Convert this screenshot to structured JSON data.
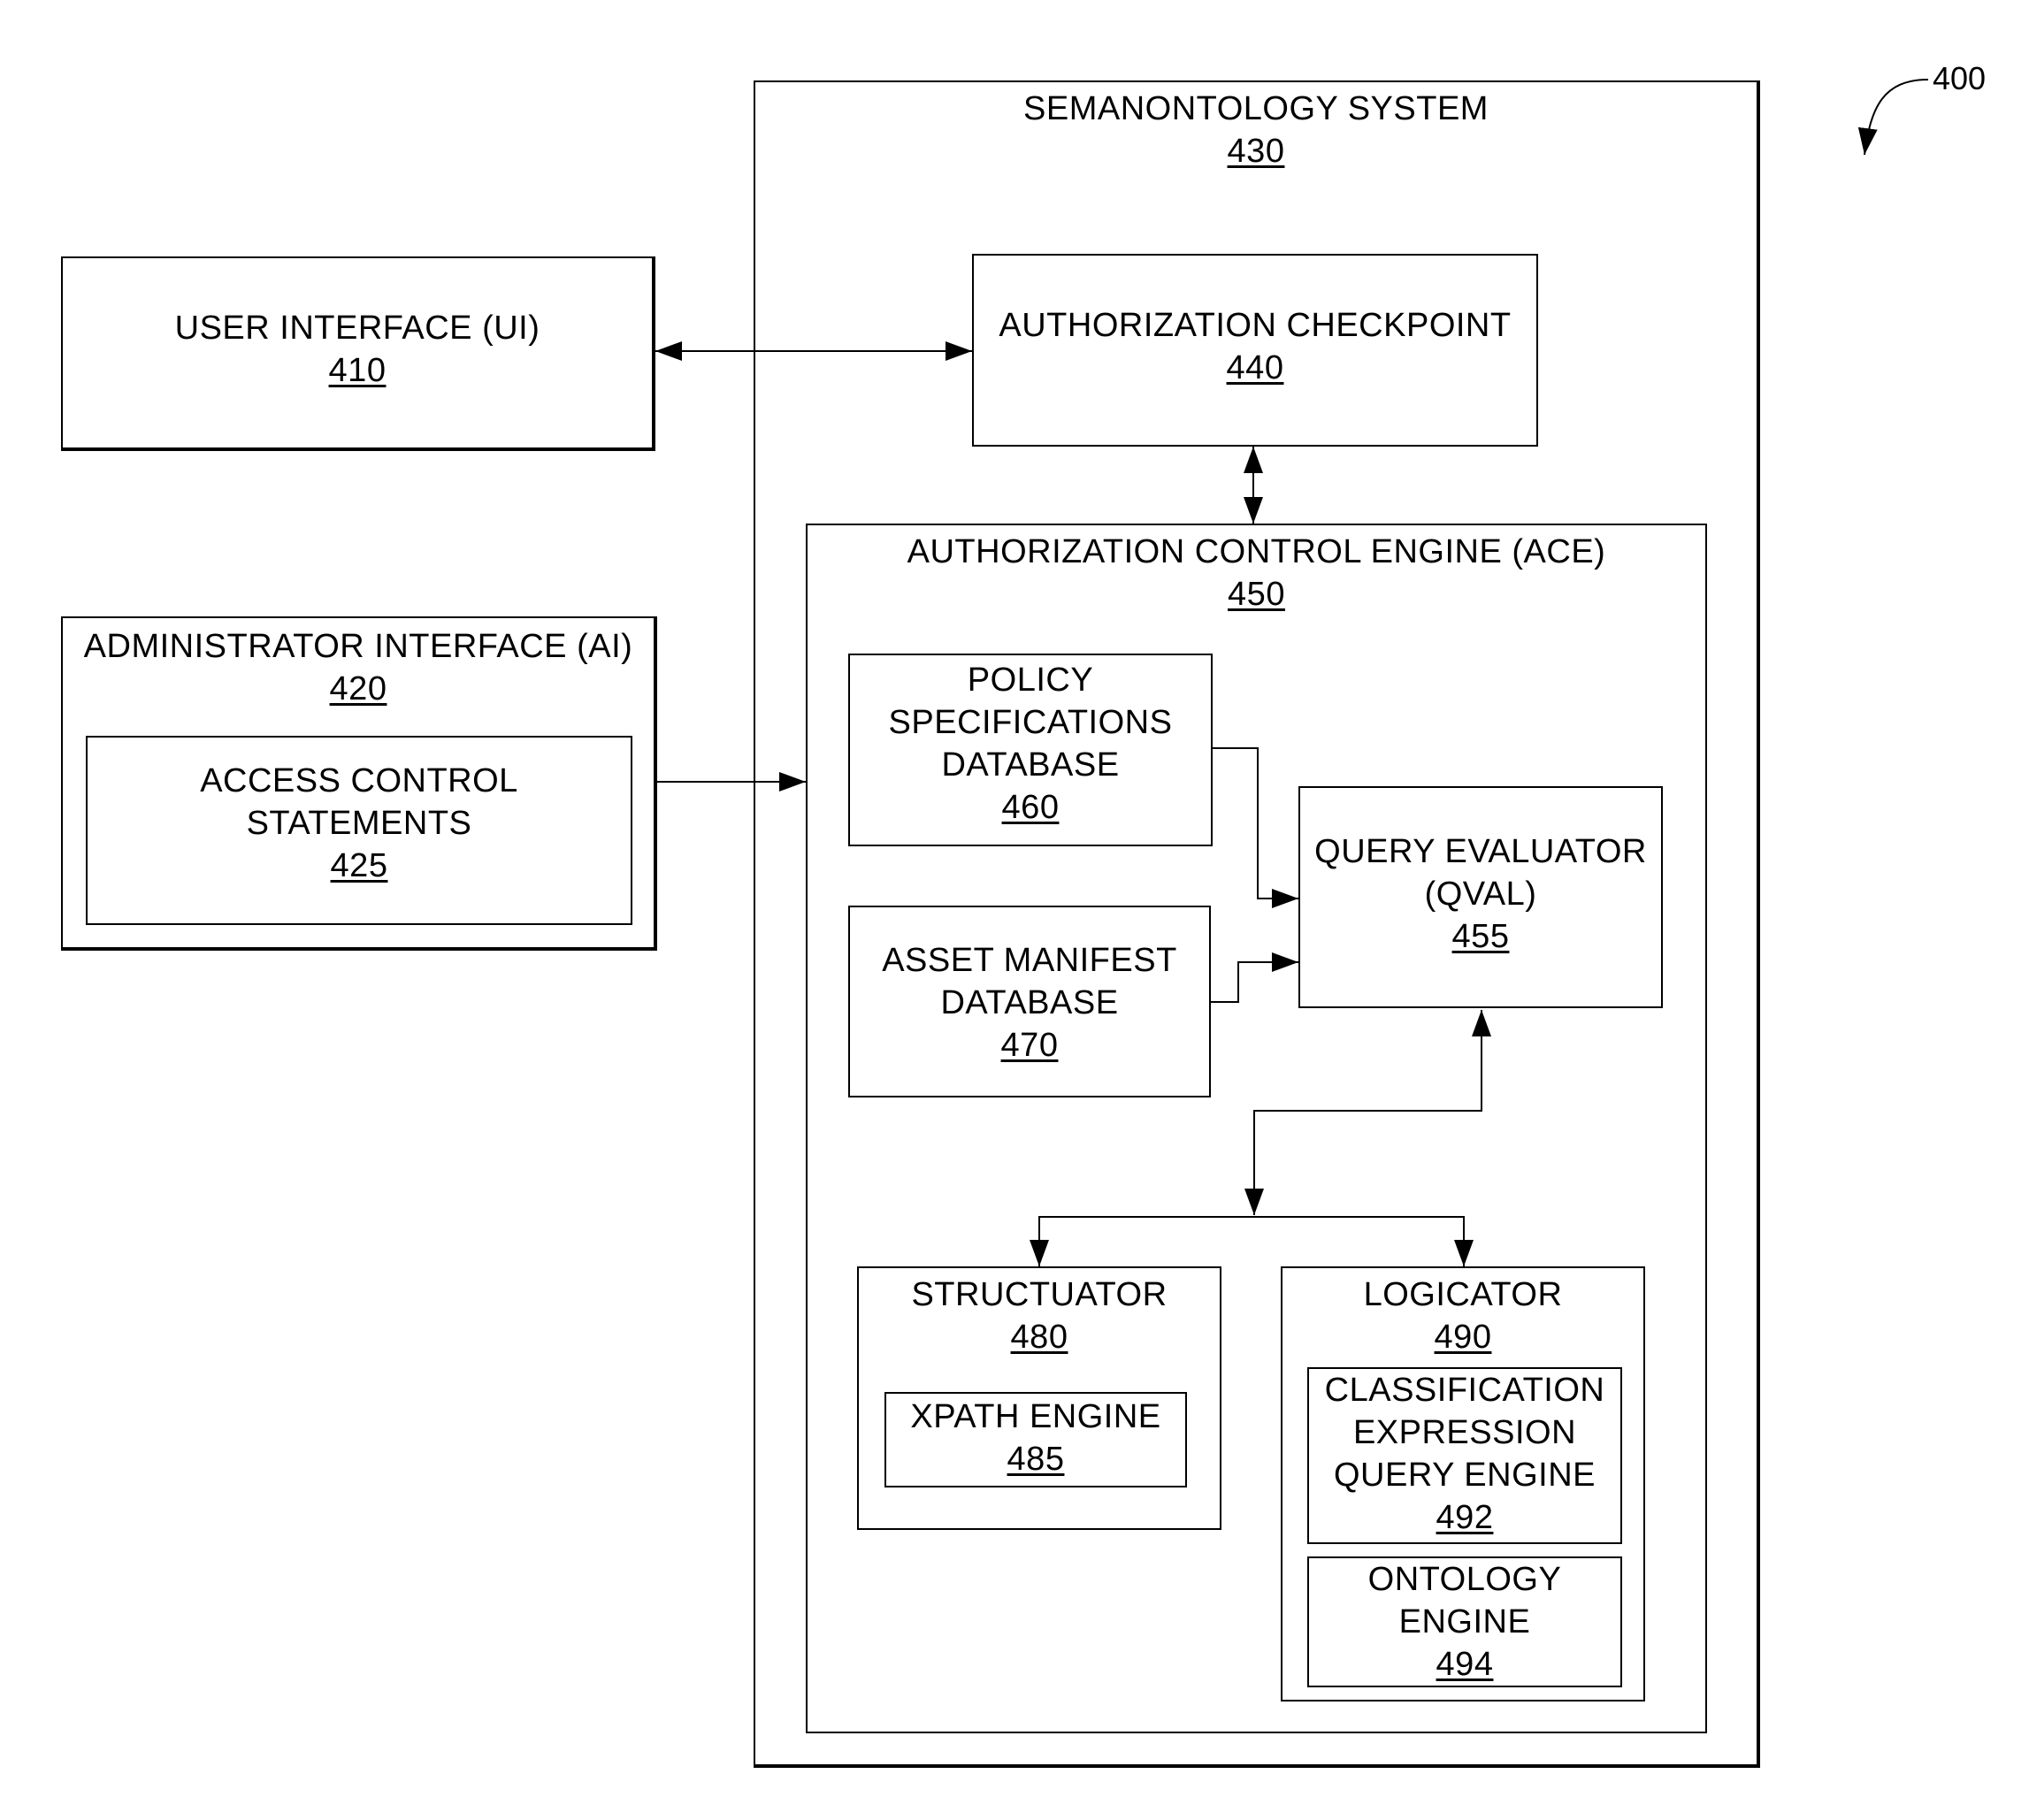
{
  "figure": {
    "ref": "400"
  },
  "user_interface": {
    "title": "USER INTERFACE (UI)",
    "num": "410"
  },
  "admin_interface": {
    "title": "ADMINISTRATOR INTERFACE (AI)",
    "num": "420"
  },
  "access_control": {
    "line1": "ACCESS CONTROL",
    "line2": "STATEMENTS",
    "num": "425"
  },
  "semanontology": {
    "title": "SEMANONTOLOGY SYSTEM",
    "num": "430"
  },
  "auth_checkpoint": {
    "title": "AUTHORIZATION CHECKPOINT",
    "num": "440"
  },
  "ace": {
    "title": "AUTHORIZATION CONTROL ENGINE (ACE)",
    "num": "450"
  },
  "query_evaluator": {
    "line1": "QUERY EVALUATOR",
    "line2": "(QVAL)",
    "num": "455"
  },
  "policy_db": {
    "line1": "POLICY",
    "line2": "SPECIFICATIONS",
    "line3": "DATABASE",
    "num": "460"
  },
  "asset_db": {
    "line1": "ASSET MANIFEST",
    "line2": "DATABASE",
    "num": "470"
  },
  "structuator": {
    "title": "STRUCTUATOR",
    "num": "480"
  },
  "xpath": {
    "title": "XPATH ENGINE",
    "num": "485"
  },
  "logicator": {
    "title": "LOGICATOR",
    "num": "490"
  },
  "classification": {
    "line1": "CLASSIFICATION",
    "line2": "EXPRESSION",
    "line3": "QUERY ENGINE",
    "num": "492"
  },
  "ontology": {
    "line1": "ONTOLOGY",
    "line2": "ENGINE",
    "num": "494"
  }
}
